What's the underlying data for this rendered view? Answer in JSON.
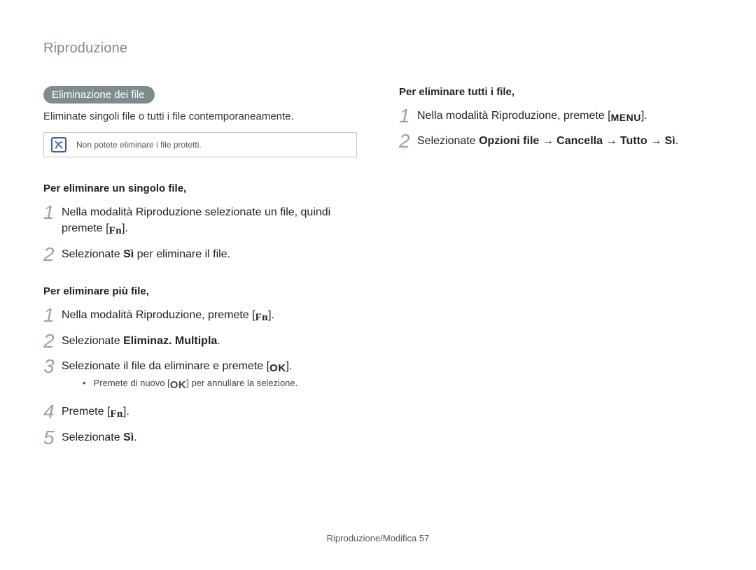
{
  "running_head": "Riproduzione",
  "left": {
    "pill": "Eliminazione dei file",
    "intro": "Eliminate singoli file o tutti i file contemporaneamente.",
    "note": "Non potete eliminare i file protetti.",
    "section1": {
      "heading": "Per eliminare un singolo file,",
      "step1_a": "Nella modalità Riproduzione selezionate un file, quindi premete [",
      "step1_b": "].",
      "step2_a": "Selezionate ",
      "step2_bold": "Sì",
      "step2_b": " per eliminare il file."
    },
    "section2": {
      "heading": "Per eliminare più file,",
      "step1_a": "Nella modalità Riproduzione, premete [",
      "step1_b": "].",
      "step2_a": "Selezionate ",
      "step2_bold": "Eliminaz. Multipla",
      "step2_b": ".",
      "step3_a": "Selezionate il file da eliminare e premete [",
      "step3_b": "].",
      "step3_sub_a": "Premete di nuovo [",
      "step3_sub_b": "] per annullare la selezione.",
      "step4_a": "Premete [",
      "step4_b": "].",
      "step5_a": "Selezionate ",
      "step5_bold": "Sì",
      "step5_b": "."
    }
  },
  "right": {
    "section1": {
      "heading": "Per eliminare tutti i file,",
      "step1_a": "Nella modalità Riproduzione, premete [",
      "step1_b": "].",
      "step2_a": "Selezionate ",
      "step2_bold": "Opzioni file → Cancella → Tutto → Sì",
      "step2_b": "."
    }
  },
  "footer_a": "Riproduzione/Modifica  ",
  "footer_page": "57"
}
